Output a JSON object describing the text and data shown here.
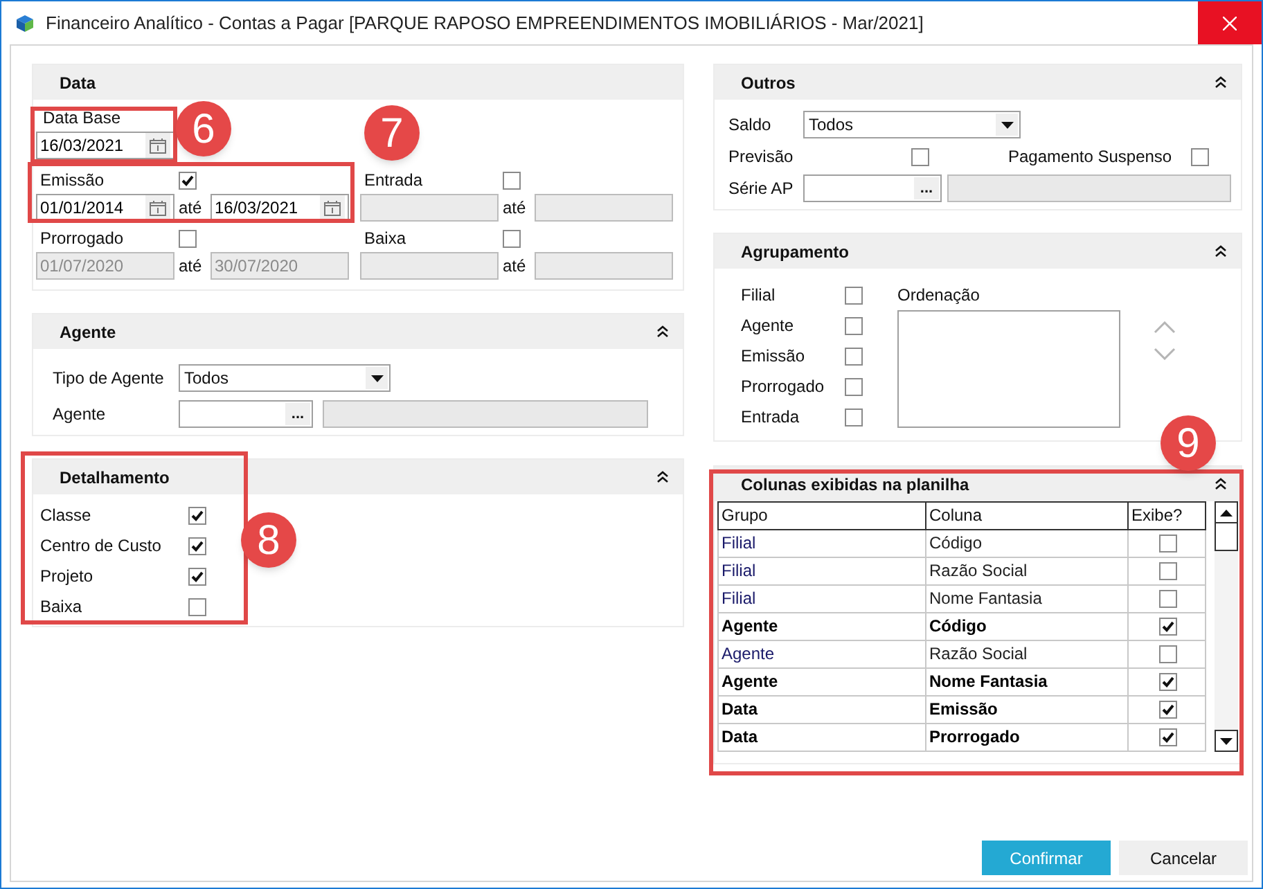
{
  "window": {
    "title": "Financeiro Analítico - Contas a Pagar [PARQUE RAPOSO EMPREENDIMENTOS IMOBILIÁRIOS - Mar/2021]"
  },
  "data_section": {
    "title": "Data",
    "data_base": {
      "label": "Data Base",
      "value": "16/03/2021"
    },
    "ranges": [
      {
        "label": "Emissão",
        "checked": true,
        "disabled": false,
        "from": "01/01/2014",
        "to": "16/03/2021",
        "until": "até"
      },
      {
        "label": "Entrada",
        "checked": false,
        "disabled": true,
        "until": "até"
      },
      {
        "label": "Prorrogado",
        "checked": false,
        "disabled": true,
        "from": "01/07/2020",
        "to": "30/07/2020",
        "until": "até"
      },
      {
        "label": "Baixa",
        "checked": false,
        "disabled": true,
        "until": "até"
      }
    ]
  },
  "agente_section": {
    "title": "Agente",
    "tipo": {
      "label": "Tipo de Agente",
      "value": "Todos"
    },
    "agente": {
      "label": "Agente",
      "button": "..."
    }
  },
  "detalhamento": {
    "title": "Detalhamento",
    "items": [
      {
        "label": "Classe",
        "checked": true
      },
      {
        "label": "Centro de Custo",
        "checked": true
      },
      {
        "label": "Projeto",
        "checked": true
      },
      {
        "label": "Baixa",
        "checked": false
      }
    ]
  },
  "outros": {
    "title": "Outros",
    "saldo": {
      "label": "Saldo",
      "value": "Todos"
    },
    "previsao": {
      "label": "Previsão",
      "checked": false
    },
    "pagamento_suspenso": {
      "label": "Pagamento Suspenso",
      "checked": false
    },
    "serie_ap": {
      "label": "Série AP",
      "button": "..."
    }
  },
  "agrupamento": {
    "title": "Agrupamento",
    "items": [
      {
        "label": "Filial",
        "checked": false
      },
      {
        "label": "Agente",
        "checked": false
      },
      {
        "label": "Emissão",
        "checked": false
      },
      {
        "label": "Prorrogado",
        "checked": false
      },
      {
        "label": "Entrada",
        "checked": false
      }
    ],
    "ordenacao": {
      "label": "Ordenação"
    }
  },
  "colunas": {
    "title": "Colunas exibidas na planilha",
    "columns": [
      "Grupo",
      "Coluna",
      "Exibe?"
    ],
    "rows": [
      {
        "grupo": "Filial",
        "coluna": "Código",
        "bold": false,
        "checked": false
      },
      {
        "grupo": "Filial",
        "coluna": "Razão Social",
        "bold": false,
        "checked": false
      },
      {
        "grupo": "Filial",
        "coluna": "Nome Fantasia",
        "bold": false,
        "checked": false
      },
      {
        "grupo": "Agente",
        "coluna": "Código",
        "bold": true,
        "checked": true
      },
      {
        "grupo": "Agente",
        "coluna": "Razão Social",
        "bold": false,
        "checked": false
      },
      {
        "grupo": "Agente",
        "coluna": "Nome Fantasia",
        "bold": true,
        "checked": true
      },
      {
        "grupo": "Data",
        "coluna": "Emissão",
        "bold": true,
        "checked": true
      },
      {
        "grupo": "Data",
        "coluna": "Prorrogado",
        "bold": true,
        "checked": true
      }
    ]
  },
  "buttons": [
    {
      "label": "Confirmar",
      "kind": "primary"
    },
    {
      "label": "Cancelar",
      "kind": "secondary"
    }
  ],
  "annotations": [
    {
      "number": "6"
    },
    {
      "number": "7"
    },
    {
      "number": "8"
    },
    {
      "number": "9"
    }
  ]
}
